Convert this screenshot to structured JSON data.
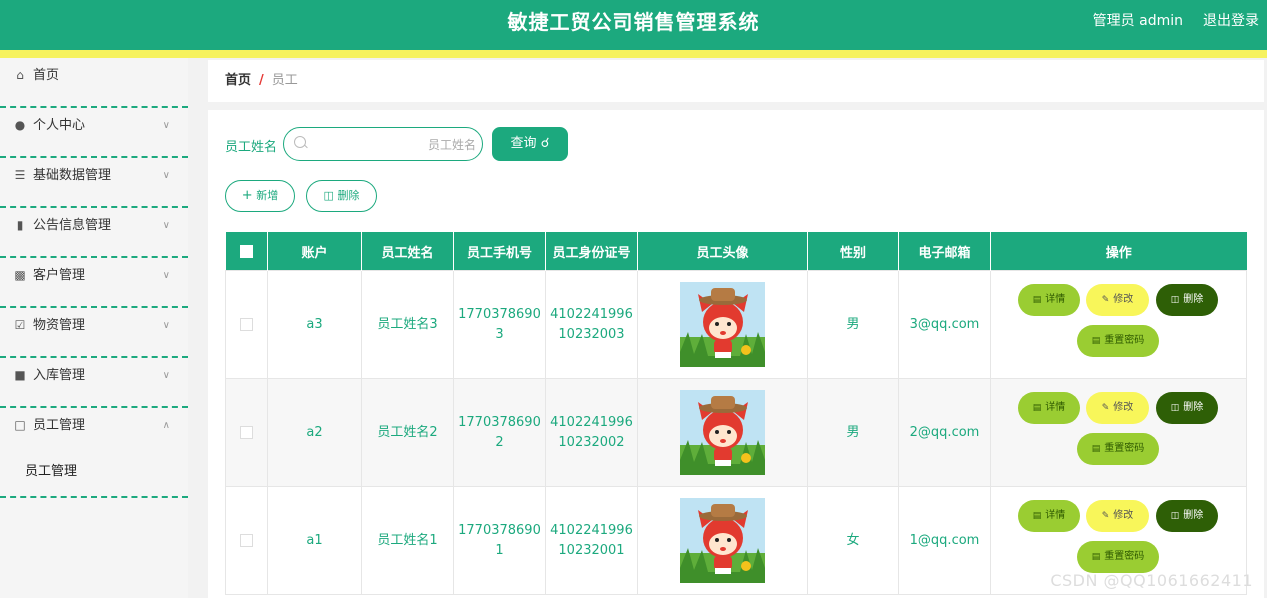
{
  "header": {
    "title": "敏捷工贸公司销售管理系统",
    "user_label": "管理员 admin",
    "logout_label": "退出登录"
  },
  "sidebar": {
    "items": [
      {
        "label": "首页",
        "icon": "home-icon"
      },
      {
        "label": "个人中心",
        "icon": "user-icon"
      },
      {
        "label": "基础数据管理",
        "icon": "list-icon"
      },
      {
        "label": "公告信息管理",
        "icon": "clipboard-icon"
      },
      {
        "label": "客户管理",
        "icon": "printer-icon"
      },
      {
        "label": "物资管理",
        "icon": "clipboard-check-icon"
      },
      {
        "label": "入库管理",
        "icon": "camera-icon"
      },
      {
        "label": "员工管理",
        "icon": "chat-icon"
      }
    ],
    "submenu_item": "员工管理"
  },
  "breadcrumb": {
    "home": "首页",
    "separator": "/",
    "current": "员工"
  },
  "search": {
    "label": "员工姓名",
    "placeholder": "员工姓名",
    "button_label": "查询"
  },
  "toolbar": {
    "add_label": "新增",
    "delete_label": "删除"
  },
  "table": {
    "headers": [
      "账户",
      "员工姓名",
      "员工手机号",
      "员工身份证号",
      "员工头像",
      "性别",
      "电子邮箱",
      "操作"
    ],
    "rows": [
      {
        "account": "a3",
        "name": "员工姓名3",
        "phone_1": "1770378690",
        "phone_2": "3",
        "id_1": "4102241996",
        "id_2": "10232003",
        "gender": "男",
        "email": "3@qq.com"
      },
      {
        "account": "a2",
        "name": "员工姓名2",
        "phone_1": "1770378690",
        "phone_2": "2",
        "id_1": "4102241996",
        "id_2": "10232002",
        "gender": "男",
        "email": "2@qq.com"
      },
      {
        "account": "a1",
        "name": "员工姓名1",
        "phone_1": "1770378690",
        "phone_2": "1",
        "id_1": "4102241996",
        "id_2": "10232001",
        "gender": "女",
        "email": "1@qq.com"
      }
    ],
    "actions": {
      "detail": "详情",
      "edit": "修改",
      "delete": "删除",
      "reset": "重置密码"
    }
  },
  "watermark": "CSDN @QQ1061662411",
  "colors": {
    "primary": "#1ca97e",
    "accent_yellow": "#f6f25e",
    "detail_button": "#9acd32",
    "edit_button": "#f8f65a",
    "delete_button": "#2e5f06"
  }
}
